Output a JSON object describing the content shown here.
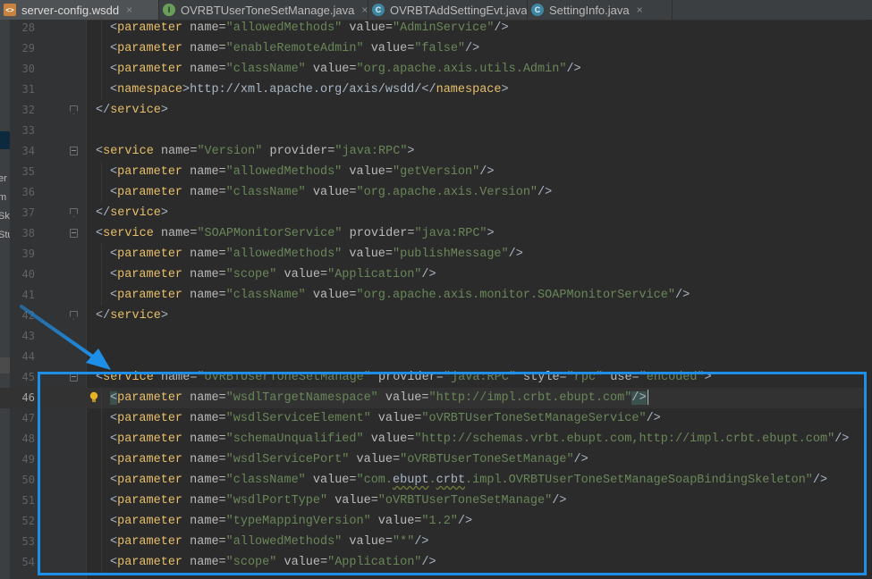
{
  "tabs": [
    {
      "label": "server-config.wsdd",
      "icon": "xml-file-icon",
      "active": true
    },
    {
      "label": "OVRBTUserToneSetManage.java",
      "icon": "interface-icon",
      "active": false
    },
    {
      "label": "OVRBTAddSettingEvt.java",
      "icon": "class-icon",
      "active": false
    },
    {
      "label": "SettingInfo.java",
      "icon": "class-icon",
      "active": false
    }
  ],
  "tab_close_glyph": "×",
  "tab_icon_letters": {
    "xml": "<>",
    "interface": "I",
    "class": "C"
  },
  "left_panel_fragments": [
    "er",
    "m",
    "Sk",
    "Stu"
  ],
  "current_line": "46",
  "colors": {
    "background": "#2b2b2b",
    "tag": "#e8bf6a",
    "attribute": "#bababa",
    "value": "#6a8759",
    "text": "#a9b7c6",
    "highlight_box": "#1e8fe8",
    "arrow": "#1e8fe8"
  },
  "lines": [
    {
      "num": "28",
      "tokens": [
        [
          "pt",
          "<"
        ],
        [
          "tg",
          "parameter"
        ],
        [
          "pt",
          " "
        ],
        [
          "at",
          "name="
        ],
        [
          "vl",
          "\"allowedMethods\""
        ],
        [
          "pt",
          " "
        ],
        [
          "at",
          "value="
        ],
        [
          "vl",
          "\"AdminService\""
        ],
        [
          "pt",
          "/>"
        ]
      ],
      "indent": 1
    },
    {
      "num": "29",
      "tokens": [
        [
          "pt",
          "<"
        ],
        [
          "tg",
          "parameter"
        ],
        [
          "pt",
          " "
        ],
        [
          "at",
          "name="
        ],
        [
          "vl",
          "\"enableRemoteAdmin\""
        ],
        [
          "pt",
          " "
        ],
        [
          "at",
          "value="
        ],
        [
          "vl",
          "\"false\""
        ],
        [
          "pt",
          "/>"
        ]
      ],
      "indent": 1
    },
    {
      "num": "30",
      "tokens": [
        [
          "pt",
          "<"
        ],
        [
          "tg",
          "parameter"
        ],
        [
          "pt",
          " "
        ],
        [
          "at",
          "name="
        ],
        [
          "vl",
          "\"className\""
        ],
        [
          "pt",
          " "
        ],
        [
          "at",
          "value="
        ],
        [
          "vl",
          "\"org.apache.axis.utils.Admin\""
        ],
        [
          "pt",
          "/>"
        ]
      ],
      "indent": 1
    },
    {
      "num": "31",
      "tokens": [
        [
          "pt",
          "<"
        ],
        [
          "tg",
          "namespace"
        ],
        [
          "pt",
          ">"
        ],
        [
          "tx",
          "http://xml.apache.org/axis/wsdd/"
        ],
        [
          "pt",
          "</"
        ],
        [
          "tg",
          "namespace"
        ],
        [
          "pt",
          ">"
        ]
      ],
      "indent": 1
    },
    {
      "num": "32",
      "tokens": [
        [
          "pt",
          "</"
        ],
        [
          "tg",
          "service"
        ],
        [
          "pt",
          ">"
        ]
      ],
      "indent": 0,
      "fold": "close"
    },
    {
      "num": "33",
      "tokens": [],
      "indent": 0
    },
    {
      "num": "34",
      "tokens": [
        [
          "pt",
          "<"
        ],
        [
          "tg",
          "service"
        ],
        [
          "pt",
          " "
        ],
        [
          "at",
          "name="
        ],
        [
          "vl",
          "\"Version\""
        ],
        [
          "pt",
          " "
        ],
        [
          "at",
          "provider="
        ],
        [
          "vl",
          "\"java:RPC\""
        ],
        [
          "pt",
          ">"
        ]
      ],
      "indent": 0,
      "fold": "open"
    },
    {
      "num": "35",
      "tokens": [
        [
          "pt",
          "<"
        ],
        [
          "tg",
          "parameter"
        ],
        [
          "pt",
          " "
        ],
        [
          "at",
          "name="
        ],
        [
          "vl",
          "\"allowedMethods\""
        ],
        [
          "pt",
          " "
        ],
        [
          "at",
          "value="
        ],
        [
          "vl",
          "\"getVersion\""
        ],
        [
          "pt",
          "/>"
        ]
      ],
      "indent": 1
    },
    {
      "num": "36",
      "tokens": [
        [
          "pt",
          "<"
        ],
        [
          "tg",
          "parameter"
        ],
        [
          "pt",
          " "
        ],
        [
          "at",
          "name="
        ],
        [
          "vl",
          "\"className\""
        ],
        [
          "pt",
          " "
        ],
        [
          "at",
          "value="
        ],
        [
          "vl",
          "\"org.apache.axis.Version\""
        ],
        [
          "pt",
          "/>"
        ]
      ],
      "indent": 1
    },
    {
      "num": "37",
      "tokens": [
        [
          "pt",
          "</"
        ],
        [
          "tg",
          "service"
        ],
        [
          "pt",
          ">"
        ]
      ],
      "indent": 0,
      "fold": "close"
    },
    {
      "num": "38",
      "tokens": [
        [
          "pt",
          "<"
        ],
        [
          "tg",
          "service"
        ],
        [
          "pt",
          " "
        ],
        [
          "at",
          "name="
        ],
        [
          "vl",
          "\"SOAPMonitorService\""
        ],
        [
          "pt",
          " "
        ],
        [
          "at",
          "provider="
        ],
        [
          "vl",
          "\"java:RPC\""
        ],
        [
          "pt",
          ">"
        ]
      ],
      "indent": 0,
      "fold": "open"
    },
    {
      "num": "39",
      "tokens": [
        [
          "pt",
          "<"
        ],
        [
          "tg",
          "parameter"
        ],
        [
          "pt",
          " "
        ],
        [
          "at",
          "name="
        ],
        [
          "vl",
          "\"allowedMethods\""
        ],
        [
          "pt",
          " "
        ],
        [
          "at",
          "value="
        ],
        [
          "vl",
          "\"publishMessage\""
        ],
        [
          "pt",
          "/>"
        ]
      ],
      "indent": 1
    },
    {
      "num": "40",
      "tokens": [
        [
          "pt",
          "<"
        ],
        [
          "tg",
          "parameter"
        ],
        [
          "pt",
          " "
        ],
        [
          "at",
          "name="
        ],
        [
          "vl",
          "\"scope\""
        ],
        [
          "pt",
          " "
        ],
        [
          "at",
          "value="
        ],
        [
          "vl",
          "\"Application\""
        ],
        [
          "pt",
          "/>"
        ]
      ],
      "indent": 1
    },
    {
      "num": "41",
      "tokens": [
        [
          "pt",
          "<"
        ],
        [
          "tg",
          "parameter"
        ],
        [
          "pt",
          " "
        ],
        [
          "at",
          "name="
        ],
        [
          "vl",
          "\"className\""
        ],
        [
          "pt",
          " "
        ],
        [
          "at",
          "value="
        ],
        [
          "vl",
          "\"org.apache.axis.monitor.SOAPMonitorService\""
        ],
        [
          "pt",
          "/>"
        ]
      ],
      "indent": 1
    },
    {
      "num": "42",
      "tokens": [
        [
          "pt",
          "</"
        ],
        [
          "tg",
          "service"
        ],
        [
          "pt",
          ">"
        ]
      ],
      "indent": 0,
      "fold": "close"
    },
    {
      "num": "43",
      "tokens": [],
      "indent": 0
    },
    {
      "num": "44",
      "tokens": [],
      "indent": 0
    },
    {
      "num": "45",
      "tokens": [
        [
          "pt",
          "<"
        ],
        [
          "tg",
          "service"
        ],
        [
          "pt",
          " "
        ],
        [
          "at",
          "name="
        ],
        [
          "vl",
          "\"oVRBTUserToneSetManage\""
        ],
        [
          "pt",
          " "
        ],
        [
          "at",
          "provider="
        ],
        [
          "vl",
          "\"java:RPC\""
        ],
        [
          "pt",
          " "
        ],
        [
          "at",
          "style="
        ],
        [
          "vl",
          "\"rpc\""
        ],
        [
          "pt",
          " "
        ],
        [
          "at",
          "use="
        ],
        [
          "vl",
          "\"encoded\""
        ],
        [
          "pt",
          ">"
        ]
      ],
      "indent": 0,
      "fold": "open"
    },
    {
      "num": "46",
      "tokens": [
        [
          "mk",
          "<"
        ],
        [
          "tg",
          "parameter"
        ],
        [
          "pt",
          " "
        ],
        [
          "at",
          "name="
        ],
        [
          "vl",
          "\"wsdlTargetNamespace\""
        ],
        [
          "pt",
          " "
        ],
        [
          "at",
          "value="
        ],
        [
          "vl",
          "\"http://impl.crbt.ebupt.com\""
        ],
        [
          "mk",
          "/>"
        ]
      ],
      "indent": 1,
      "current": true,
      "bulb": true
    },
    {
      "num": "47",
      "tokens": [
        [
          "pt",
          "<"
        ],
        [
          "tg",
          "parameter"
        ],
        [
          "pt",
          " "
        ],
        [
          "at",
          "name="
        ],
        [
          "vl",
          "\"wsdlServiceElement\""
        ],
        [
          "pt",
          " "
        ],
        [
          "at",
          "value="
        ],
        [
          "vl",
          "\"oVRBTUserToneSetManageService\""
        ],
        [
          "pt",
          "/>"
        ]
      ],
      "indent": 1
    },
    {
      "num": "48",
      "tokens": [
        [
          "pt",
          "<"
        ],
        [
          "tg",
          "parameter"
        ],
        [
          "pt",
          " "
        ],
        [
          "at",
          "name="
        ],
        [
          "vl",
          "\"schemaUnqualified\""
        ],
        [
          "pt",
          " "
        ],
        [
          "at",
          "value="
        ],
        [
          "vl",
          "\"http://schemas.vrbt.ebupt.com,http://impl.crbt.ebupt.com\""
        ],
        [
          "pt",
          "/>"
        ]
      ],
      "indent": 1
    },
    {
      "num": "49",
      "tokens": [
        [
          "pt",
          "<"
        ],
        [
          "tg",
          "parameter"
        ],
        [
          "pt",
          " "
        ],
        [
          "at",
          "name="
        ],
        [
          "vl",
          "\"wsdlServicePort\""
        ],
        [
          "pt",
          " "
        ],
        [
          "at",
          "value="
        ],
        [
          "vl",
          "\"oVRBTUserToneSetManage\""
        ],
        [
          "pt",
          "/>"
        ]
      ],
      "indent": 1
    },
    {
      "num": "50",
      "tokens": [
        [
          "pt",
          "<"
        ],
        [
          "tg",
          "parameter"
        ],
        [
          "pt",
          " "
        ],
        [
          "at",
          "name="
        ],
        [
          "vl",
          "\"className\""
        ],
        [
          "pt",
          " "
        ],
        [
          "at",
          "value="
        ],
        [
          "vl",
          "\"com."
        ],
        [
          "ul",
          "ebupt"
        ],
        [
          "vl",
          "."
        ],
        [
          "ul",
          "crbt"
        ],
        [
          "vl",
          ".impl.OVRBTUserToneSetManageSoapBindingSkeleton\""
        ],
        [
          "pt",
          "/>"
        ]
      ],
      "indent": 1
    },
    {
      "num": "51",
      "tokens": [
        [
          "pt",
          "<"
        ],
        [
          "tg",
          "parameter"
        ],
        [
          "pt",
          " "
        ],
        [
          "at",
          "name="
        ],
        [
          "vl",
          "\"wsdlPortType\""
        ],
        [
          "pt",
          " "
        ],
        [
          "at",
          "value="
        ],
        [
          "vl",
          "\"oVRBTUserToneSetManage\""
        ],
        [
          "pt",
          "/>"
        ]
      ],
      "indent": 1
    },
    {
      "num": "52",
      "tokens": [
        [
          "pt",
          "<"
        ],
        [
          "tg",
          "parameter"
        ],
        [
          "pt",
          " "
        ],
        [
          "at",
          "name="
        ],
        [
          "vl",
          "\"typeMappingVersion\""
        ],
        [
          "pt",
          " "
        ],
        [
          "at",
          "value="
        ],
        [
          "vl",
          "\"1.2\""
        ],
        [
          "pt",
          "/>"
        ]
      ],
      "indent": 1
    },
    {
      "num": "53",
      "tokens": [
        [
          "pt",
          "<"
        ],
        [
          "tg",
          "parameter"
        ],
        [
          "pt",
          " "
        ],
        [
          "at",
          "name="
        ],
        [
          "vl",
          "\"allowedMethods\""
        ],
        [
          "pt",
          " "
        ],
        [
          "at",
          "value="
        ],
        [
          "vl",
          "\"*\""
        ],
        [
          "pt",
          "/>"
        ]
      ],
      "indent": 1
    },
    {
      "num": "54",
      "tokens": [
        [
          "pt",
          "<"
        ],
        [
          "tg",
          "parameter"
        ],
        [
          "pt",
          " "
        ],
        [
          "at",
          "name="
        ],
        [
          "vl",
          "\"scope\""
        ],
        [
          "pt",
          " "
        ],
        [
          "at",
          "value="
        ],
        [
          "vl",
          "\"Application\""
        ],
        [
          "pt",
          "/>"
        ]
      ],
      "indent": 1
    }
  ]
}
